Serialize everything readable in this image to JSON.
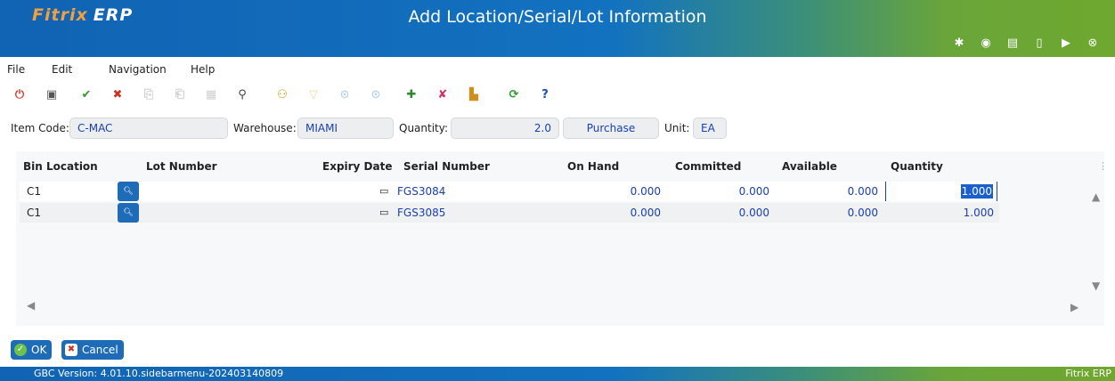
{
  "app": {
    "logo_main": "Fitrix",
    "logo_suffix": "ERP",
    "window_title": "Add Location/Serial/Lot Information"
  },
  "title_icons": [
    "gear-icon",
    "target-icon",
    "document-icon",
    "blank-page-icon",
    "play-icon",
    "close-icon"
  ],
  "menu": [
    "File",
    "Edit",
    "Navigation",
    "Help"
  ],
  "toolbar": [
    {
      "name": "power-icon",
      "glyph": "⏻",
      "color": "#e04030",
      "enabled": true
    },
    {
      "name": "copy-window-icon",
      "glyph": "▣",
      "color": "#555555",
      "enabled": true
    },
    {
      "name": "accept-icon",
      "glyph": "✔",
      "color": "#2e9c2e",
      "enabled": true
    },
    {
      "name": "cancel-icon",
      "glyph": "✖",
      "color": "#d03020",
      "enabled": true
    },
    {
      "name": "copy-icon",
      "glyph": "⎘",
      "color": "#777777",
      "enabled": false
    },
    {
      "name": "paste-icon",
      "glyph": "⎗",
      "color": "#777777",
      "enabled": false
    },
    {
      "name": "grid-icon",
      "glyph": "▦",
      "color": "#777777",
      "enabled": false
    },
    {
      "name": "search-icon",
      "glyph": "⚲",
      "color": "#444444",
      "enabled": true
    },
    {
      "name": "user-search-icon",
      "glyph": "⚇",
      "color": "#c89b10",
      "enabled": true
    },
    {
      "name": "filter-icon",
      "glyph": "▽",
      "color": "#c89b10",
      "enabled": false
    },
    {
      "name": "down-circle-icon",
      "glyph": "⊙",
      "color": "#3a7bd5",
      "enabled": false
    },
    {
      "name": "up-circle-icon",
      "glyph": "⊙",
      "color": "#3a7bd5",
      "enabled": false
    },
    {
      "name": "add-row-icon",
      "glyph": "✚",
      "color": "#2a8a2a",
      "enabled": true
    },
    {
      "name": "delete-row-icon",
      "glyph": "✘",
      "color": "#d03060",
      "enabled": true
    },
    {
      "name": "chart-icon",
      "glyph": "▙",
      "color": "#d09020",
      "enabled": true
    },
    {
      "name": "refresh-icon",
      "glyph": "⟳",
      "color": "#2e9c2e",
      "enabled": true
    },
    {
      "name": "help-icon",
      "glyph": "?",
      "color": "#1a4fb0",
      "enabled": true
    }
  ],
  "header": {
    "item_code_label": "Item Code:",
    "item_code": "C-MAC",
    "warehouse_label": "Warehouse:",
    "warehouse": "MIAMI",
    "quantity_label": "Quantity:",
    "quantity": "2.0",
    "type": "Purchase",
    "unit_label": "Unit:",
    "unit": "EA"
  },
  "grid": {
    "columns": [
      "Bin Location",
      "Lot Number",
      "Expiry Date",
      "Serial Number",
      "On Hand",
      "Committed",
      "Available",
      "Quantity"
    ],
    "rows": [
      {
        "bin": "C1",
        "lot": "",
        "expiry": "",
        "serial": "FGS3084",
        "on_hand": "0.000",
        "committed": "0.000",
        "available": "0.000",
        "quantity": "1.000"
      },
      {
        "bin": "C1",
        "lot": "",
        "expiry": "",
        "serial": "FGS3085",
        "on_hand": "0.000",
        "committed": "0.000",
        "available": "0.000",
        "quantity": "1.000"
      }
    ]
  },
  "buttons": {
    "ok": "OK",
    "cancel": "Cancel"
  },
  "status": {
    "version": "GBC Version: 4.01.10.sidebarmenu-202403140809",
    "brand": "Fitrix ERP"
  }
}
